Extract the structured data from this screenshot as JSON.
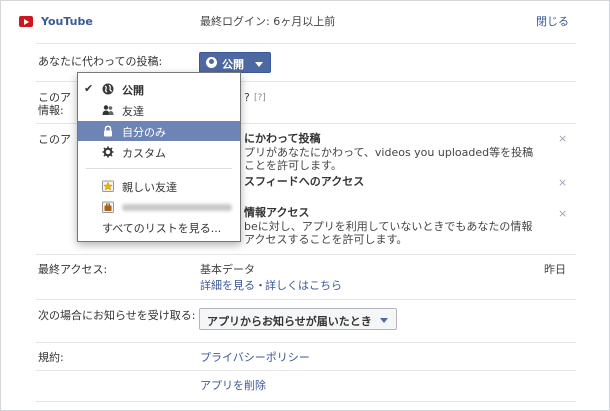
{
  "app": {
    "name": "YouTube",
    "last_login": "最終ログイン: 6ヶ月以上前",
    "close_label": "閉じる"
  },
  "posting": {
    "label": "あなたに代わっての投稿:",
    "privacy_value": "公開"
  },
  "partial_rows": {
    "row1_label_a": "このア",
    "row1_label_b": "情報:",
    "row1_help": "[?]",
    "row1_fragment": "?",
    "row2_label": "このア"
  },
  "permissions": {
    "item1_title": "にかわって投稿",
    "item1_desc_1": "プリがあなたにかわって、videos you uploaded等を投稿",
    "item1_desc_2": "ことを許可します。",
    "item2_title": "スフィードへのアクセス",
    "item3_title": "情報アクセス",
    "item3_desc_1": "beに対し、アプリを利用していないときでもあなたの情報",
    "item3_desc_2": "アクセスすることを許可します。",
    "remove_glyph": "×"
  },
  "dropdown": {
    "items": [
      {
        "label": "公開",
        "icon": "globe-icon",
        "checked": true
      },
      {
        "label": "友達",
        "icon": "friends-icon",
        "checked": false
      },
      {
        "label": "自分のみ",
        "icon": "lock-icon",
        "checked": false,
        "highlighted": true
      },
      {
        "label": "カスタム",
        "icon": "gear-icon",
        "checked": false
      },
      {
        "label": "親しい友達",
        "icon": "star-list-icon",
        "checked": false
      },
      {
        "label": "",
        "icon": "briefcase-icon",
        "checked": false,
        "blurred": true
      },
      {
        "label": "すべてのリストを見る...",
        "icon": "",
        "checked": false
      }
    ],
    "check_glyph": "✔"
  },
  "last_access": {
    "label": "最終アクセス:",
    "value": "基本データ",
    "details_link": "詳細を見る",
    "separator": "・",
    "more_link": "詳しくはこちら",
    "when": "昨日"
  },
  "notify": {
    "label": "次の場合にお知らせを受け取る:",
    "value": "アプリからお知らせが届いたとき"
  },
  "terms": {
    "label": "規約:",
    "privacy_link": "プライバシーポリシー",
    "remove_link": "アプリを削除"
  },
  "colors": {
    "link": "#3b5998",
    "youtube_red": "#cc181e",
    "selection": "#6d84b4",
    "button_blue": "#4e69a2"
  }
}
